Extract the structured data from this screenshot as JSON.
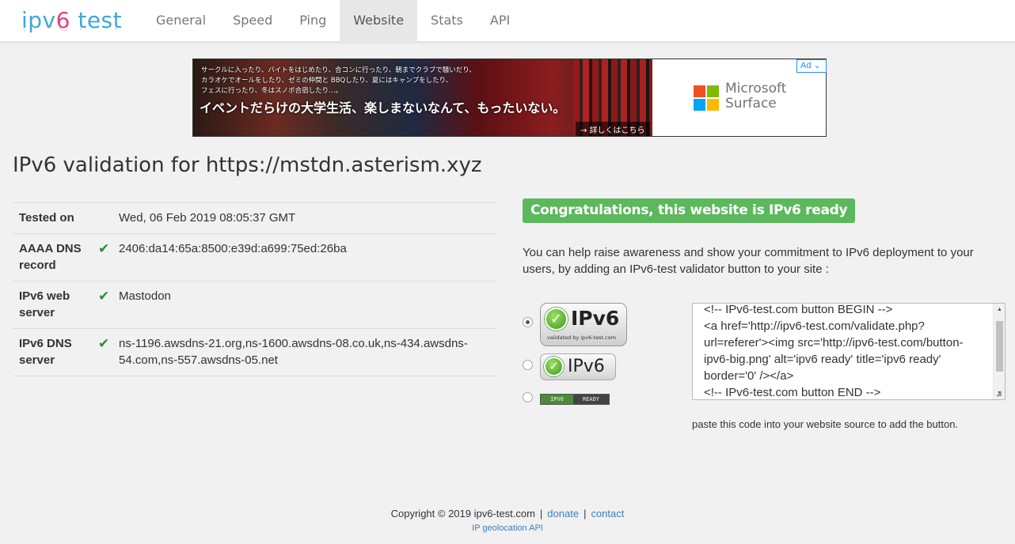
{
  "brand": {
    "part1": "ipv",
    "part2": "6",
    "part3": " test"
  },
  "nav": {
    "items": [
      "General",
      "Speed",
      "Ping",
      "Website",
      "Stats",
      "API"
    ],
    "active": "Website"
  },
  "ad": {
    "text_line1": "サークルに入ったり、バイトをはじめたり、合コンに行ったり、朝までクラブで騒いだり、",
    "text_line2": "カラオケでオールをしたり、ゼミの仲間と BBQしたり、夏にはキャンプをしたり、",
    "text_line3": "フェスに行ったり、冬はスノボ合宿したり…。",
    "headline": "イベントだらけの大学生活、楽しまないなんて、もったいない。",
    "cta": "→ 詳しくはこちら",
    "brand_line1": "Microsoft",
    "brand_line2": "Surface",
    "badge": "Ad ⌄",
    "colors": {
      "ms_red": "#f25022",
      "ms_green": "#7fba00",
      "ms_blue": "#00a4ef",
      "ms_yellow": "#ffb900"
    }
  },
  "title": "IPv6 validation for https://mstdn.asterism.xyz",
  "results": [
    {
      "key": "Tested on",
      "check": "",
      "value": "Wed, 06 Feb 2019 08:05:37 GMT"
    },
    {
      "key": "AAAA DNS record",
      "check": "✔",
      "value": "2406:da14:65a:8500:e39d:a699:75ed:26ba"
    },
    {
      "key": "IPv6 web server",
      "check": "✔",
      "value": "Mastodon"
    },
    {
      "key": "IPv6 DNS server",
      "check": "✔",
      "value": "ns-1196.awsdns-21.org,ns-1600.awsdns-08.co.uk,ns-434.awsdns-54.com,ns-557.awsdns-05.net"
    }
  ],
  "congrats": "Congratulations, this website is IPv6 ready",
  "help_text": "You can help raise awareness and show your commitment to IPv6 deployment to your users, by adding an IPv6-test validator button to your site :",
  "badges": {
    "selected": "big",
    "big_word": "IPv6",
    "big_sub": "validated by ipv6-test.com",
    "mid_word": "IPv6",
    "small_left": "IPV6",
    "small_right": "READY"
  },
  "code_snippet": "<!-- IPv6-test.com button BEGIN -->\n<a href='http://ipv6-test.com/validate.php?url=referer'><img src='http://ipv6-test.com/button-ipv6-big.png' alt='ipv6 ready' title='ipv6 ready' border='0' /></a>\n<!-- IPv6-test.com button END -->",
  "paste_note": "paste this code into your website source to add the button.",
  "footer": {
    "copyright": "Copyright © 2019 ipv6-test.com",
    "donate": "donate",
    "contact": "contact",
    "separator": "|",
    "geo_link": "IP geolocation API"
  }
}
